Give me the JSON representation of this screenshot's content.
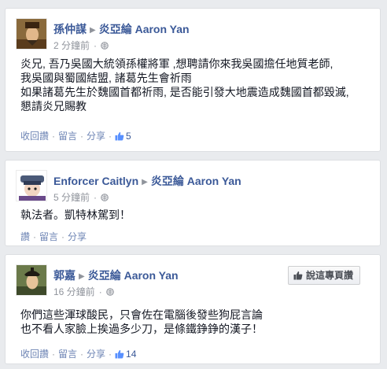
{
  "posts": [
    {
      "author": "孫仲謀",
      "target": "炎亞綸 Aaron Yan",
      "time": "2 分鐘前",
      "lines": [
        "炎兄, 吾乃吳國大統領孫權將軍 ,想聘請你來我吳國擔任地質老師,",
        "我吳國與蜀國結盟, 諸葛先生會祈雨",
        "如果諸葛先生於魏國首都祈雨, 是否能引發大地震造成魏國首都毀滅,",
        "懇請炎兄賜教"
      ],
      "actions": {
        "reply": "收回讚",
        "comment": "留言",
        "share": "分享",
        "likes": "5"
      }
    },
    {
      "author": "Enforcer Caitlyn",
      "target": "炎亞綸 Aaron Yan",
      "time": "5 分鐘前",
      "lines": [
        "執法者。凱特林駕到！"
      ],
      "actions": {
        "like": "讚",
        "comment": "留言",
        "share": "分享"
      }
    },
    {
      "author": "郭嘉",
      "target": "炎亞綸 Aaron Yan",
      "time": "16 分鐘前",
      "like_page_label": "說這專頁讚",
      "lines": [
        "你們這些渾球酸民，只會佐在電腦後發些狗屁言論",
        "也不看人家臉上挨過多少刀，是條鐵錚錚的漢子！"
      ],
      "actions": {
        "reply": "收回讚",
        "comment": "留言",
        "share": "分享",
        "likes": "14"
      }
    }
  ],
  "icons": {
    "separator": "triangle-right-icon",
    "privacy": "globe-icon",
    "like": "thumbs-up-icon"
  },
  "colors": {
    "link": "#3b5998",
    "action": "#6d84b4",
    "muted": "#90949c",
    "background": "#e9ebee"
  }
}
